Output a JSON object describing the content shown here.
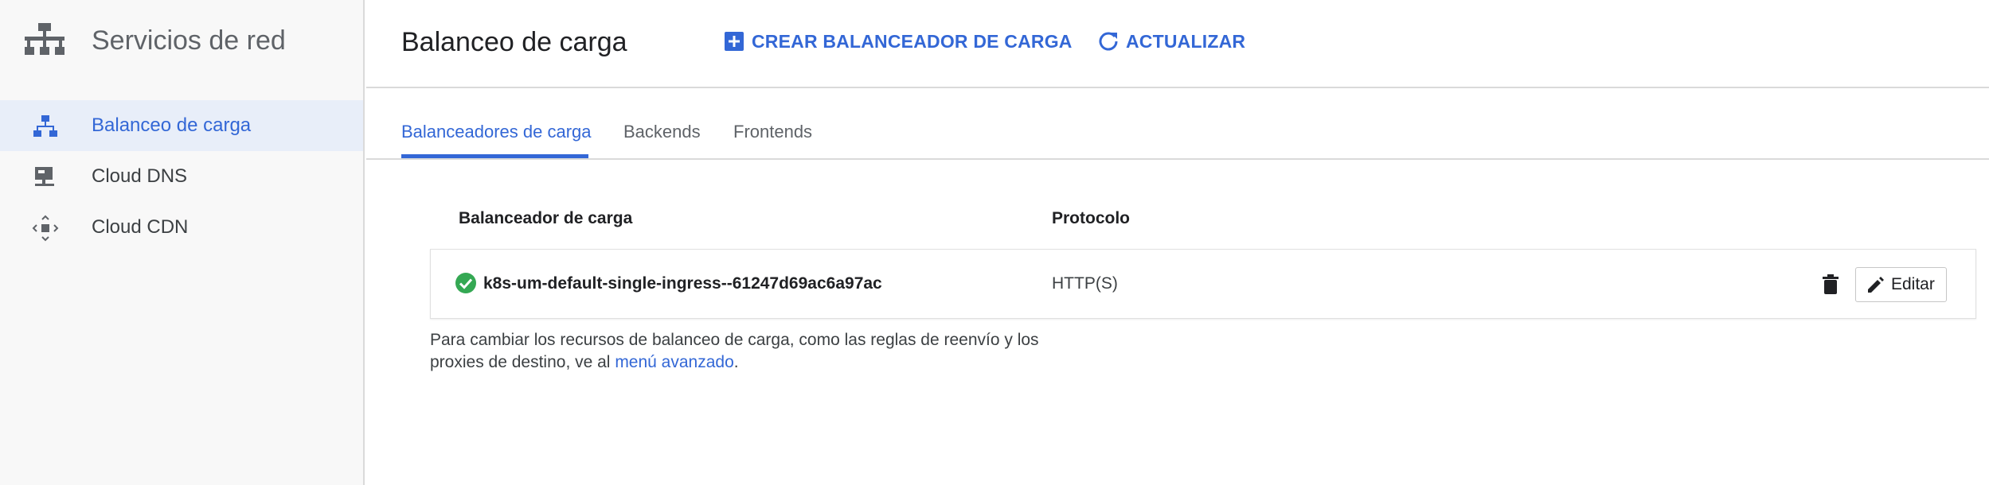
{
  "sidebar": {
    "title": "Servicios de red",
    "items": [
      {
        "label": "Balanceo de carga",
        "icon": "load-balancing-icon",
        "active": true
      },
      {
        "label": "Cloud DNS",
        "icon": "dns-icon",
        "active": false
      },
      {
        "label": "Cloud CDN",
        "icon": "cdn-icon",
        "active": false
      }
    ]
  },
  "header": {
    "title": "Balanceo de carga",
    "create_label": "CREAR BALANCEADOR DE CARGA",
    "refresh_label": "ACTUALIZAR"
  },
  "tabs": [
    {
      "label": "Balanceadores de carga",
      "active": true
    },
    {
      "label": "Backends",
      "active": false
    },
    {
      "label": "Frontends",
      "active": false
    }
  ],
  "table": {
    "columns": [
      "Balanceador de carga",
      "Protocolo"
    ],
    "rows": [
      {
        "name": "k8s-um-default-single-ingress--61247d69ac6a97ac",
        "protocol": "HTTP(S)",
        "status": "ok",
        "edit_label": "Editar"
      }
    ]
  },
  "note": {
    "text_before": "Para cambiar los recursos de balanceo de carga, como las reglas de reenvío y los proxies de destino, ve al ",
    "link": "menú avanzado",
    "text_after": "."
  },
  "colors": {
    "accent": "#3367d6",
    "success": "#34a853",
    "sidebar_bg": "#f8f8f8",
    "active_bg": "#e8eef9"
  }
}
